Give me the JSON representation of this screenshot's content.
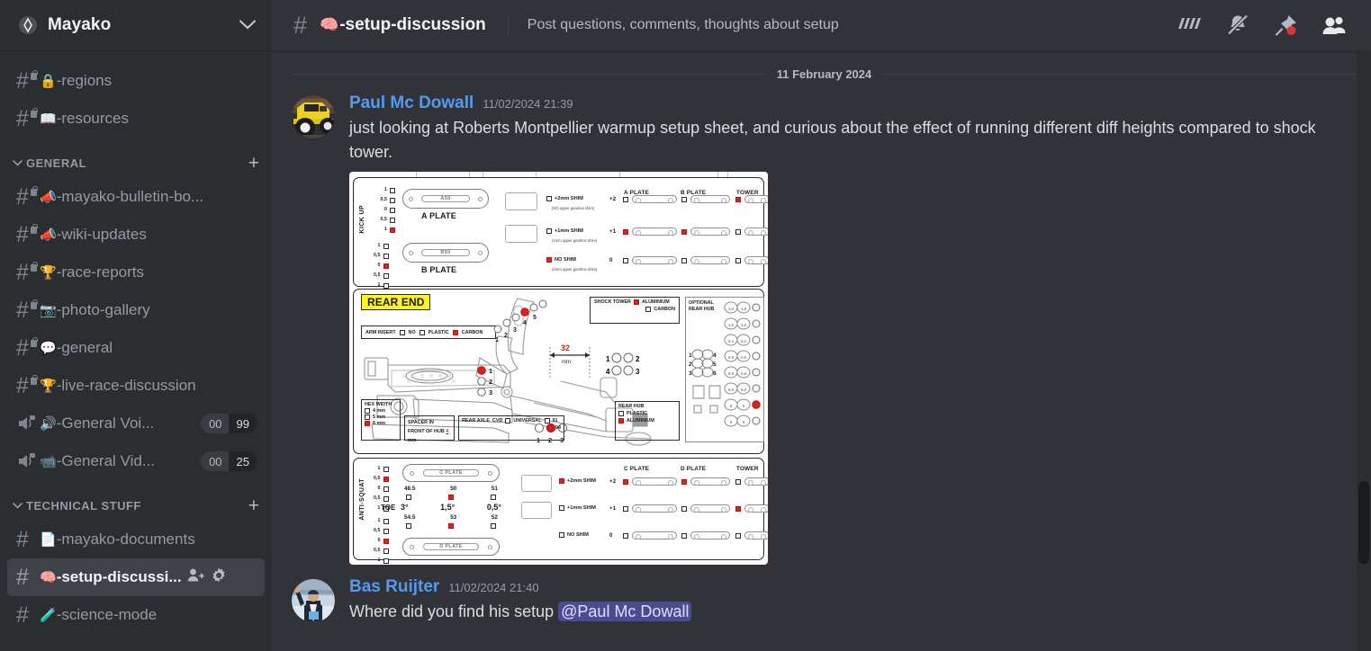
{
  "server": {
    "name": "Mayako",
    "icon": "server-diamond-icon",
    "collapse_icon": "chevron-down-icon"
  },
  "sidebar": {
    "top_channels": [
      {
        "emoji": "🔒",
        "name": "-regions",
        "locked": true,
        "type": "text"
      },
      {
        "emoji": "📖",
        "name": "-resources",
        "locked": true,
        "type": "text"
      }
    ],
    "categories": [
      {
        "label": "GENERAL",
        "add_label": "+",
        "channels": [
          {
            "emoji": "📣",
            "name": "-mayako-bulletin-bo...",
            "locked": true,
            "type": "text"
          },
          {
            "emoji": "📣",
            "name": "-wiki-updates",
            "locked": true,
            "type": "text"
          },
          {
            "emoji": "🏆",
            "name": "-race-reports",
            "locked": true,
            "type": "text"
          },
          {
            "emoji": "📷",
            "name": "-photo-gallery",
            "locked": true,
            "type": "text"
          },
          {
            "emoji": "💬",
            "name": "-general",
            "locked": true,
            "type": "text"
          },
          {
            "emoji": "🏆",
            "name": "-live-race-discussion",
            "locked": true,
            "type": "text"
          },
          {
            "emoji": "🔊",
            "name": "-General Voi...",
            "locked": true,
            "type": "voice",
            "badge_left": "00",
            "badge_right": "99"
          },
          {
            "emoji": "📹",
            "name": "-General Vid...",
            "locked": true,
            "type": "voice",
            "badge_left": "00",
            "badge_right": "25"
          }
        ]
      },
      {
        "label": "TECHNICAL STUFF",
        "add_label": "+",
        "channels": [
          {
            "emoji": "📄",
            "name": "-mayako-documents",
            "locked": false,
            "type": "text"
          },
          {
            "emoji": "🧠",
            "name": "-setup-discussi...",
            "locked": false,
            "type": "text",
            "active": true,
            "trailing_icons": [
              "add-member-icon",
              "gear-icon"
            ]
          },
          {
            "emoji": "🧪",
            "name": "-science-mode",
            "locked": false,
            "type": "text"
          }
        ]
      }
    ]
  },
  "header": {
    "hash": "#",
    "channel_emoji": "🧠",
    "channel_name": "-setup-discussion",
    "topic": "Post questions, comments, thoughts about setup",
    "icons": [
      {
        "name": "threads-icon",
        "label": "Threads"
      },
      {
        "name": "bell-muted-icon",
        "label": "Notification Settings Muted"
      },
      {
        "name": "pin-icon",
        "label": "Pinned Messages",
        "has_dot": true,
        "dot_color": "#da373c"
      },
      {
        "name": "members-icon",
        "label": "Show Member List"
      }
    ]
  },
  "chat": {
    "date_separator": "11 February 2024",
    "messages": [
      {
        "author": "Paul Mc Dowall",
        "timestamp": "11/02/2024 21:39",
        "avatar": "rc-truck-avatar",
        "text": "just looking at Roberts Montpellier warmup setup sheet, and curious about the effect of running different diff heights compared to shock tower.",
        "attachment": "setup-sheet-image"
      },
      {
        "author": "Bas Ruijter",
        "timestamp": "11/02/2024 21:40",
        "avatar": "person-avatar",
        "text_before": "Where did you find his setup ",
        "mention": "@Paul Mc Dowall"
      }
    ]
  },
  "setup_sheet": {
    "kick_up": {
      "label": "KICK UP",
      "a_plate_scale": [
        "1",
        "0,5",
        "0",
        "0,5",
        "1"
      ],
      "a_plate_selected": 4,
      "b_plate_scale": [
        "1",
        "0,5",
        "0",
        "0,5",
        "1"
      ],
      "b_plate_selected": 2,
      "a_plate_name": "A PLATE",
      "a_plate_code": "A50",
      "b_plate_name": "B PLATE",
      "b_plate_code": "B50",
      "shim_rows": [
        {
          "label": "+2mm SHIM",
          "note": "(NO upper gearbox shim)",
          "selected": false,
          "offset": "+2",
          "a_plate": false,
          "b_plate": false,
          "tower": true
        },
        {
          "label": "+1mm SHIM",
          "note": "(1mm upper gearbox shim)",
          "selected": false,
          "offset": "+1",
          "a_plate": true,
          "b_plate": true,
          "tower": false
        },
        {
          "label": "NO SHIM",
          "note": "(2mm upper gearbox shim)",
          "selected": true,
          "offset": "0",
          "a_plate": false,
          "b_plate": false,
          "tower": false
        }
      ],
      "col_headers": [
        "A PLATE",
        "B PLATE",
        "TOWER"
      ]
    },
    "rear_end": {
      "title": "REAR END",
      "arm_insert": {
        "label": "ARM INSERT",
        "options": [
          "NO",
          "PLASTIC",
          "CARBON"
        ],
        "selected": "CARBON"
      },
      "shock_tower": {
        "label": "SHOCK TOWER",
        "options": [
          "ALUMINIUM",
          "CARBON"
        ],
        "selected": "ALUMINIUM"
      },
      "optional_rear_hub": "OPTIONAL REAR HUB",
      "hub_numbers_left": [
        "1",
        "2",
        "3"
      ],
      "hub_numbers_right": [
        "4",
        "5",
        "6"
      ],
      "camber_positions": [
        "1",
        "2",
        "3",
        "4",
        "5"
      ],
      "camber_selected": 3,
      "arm_positions": [
        "1",
        "2",
        "3"
      ],
      "arm_selected": 1,
      "measure": "32",
      "measure_unit": "mm",
      "roll_numbers_top": [
        "1",
        "2"
      ],
      "roll_numbers_bottom": [
        "4",
        "3"
      ],
      "ride_positions": [
        "1",
        "2",
        "3"
      ],
      "ride_selected": 2,
      "hex_width": {
        "label": "HEX WIDTH",
        "options": [
          "4 mm",
          "5 mm",
          "6 mm"
        ],
        "selected": "6 mm"
      },
      "spacer": {
        "label": "SPACER IN FRONT OF HUB",
        "value": "4",
        "unit": "mm"
      },
      "rear_axle": {
        "label": "REAR AXLE",
        "cvd": "CVD",
        "universal": "UNIVERSAL",
        "opt91": "91",
        "opt94": "94",
        "selected": "94"
      },
      "rear_hub": {
        "label": "REAR HUB",
        "options": [
          "PLASTIC",
          "ALUMINIUM"
        ],
        "selected": "ALUMINIUM"
      },
      "hub_col_labels": [
        "1.0",
        "1.0",
        "1.0",
        "1.0",
        "0.1",
        "0.1",
        "0.5",
        "0.5",
        "0.5",
        "0.5",
        "5.0",
        "5.0",
        "0",
        "0",
        "0",
        "0",
        "0",
        "0"
      ]
    },
    "anti_squat": {
      "label": "ANTI-SQUAT",
      "c_plate_scale": [
        "1",
        "0,5",
        "0",
        "0,5",
        "1"
      ],
      "c_plate_selected": 1,
      "d_plate_scale": [
        "1",
        "0,5",
        "0",
        "0,5",
        "1"
      ],
      "d_plate_selected": 2,
      "c_plate_name": "C PLATE",
      "d_plate_name": "D PLATE",
      "toe_label": "TOE",
      "toe_top_values": [
        "48.5",
        "50",
        "51"
      ],
      "toe_top_selected": 1,
      "toe_angles": [
        "3°",
        "1,5°",
        "0,5°"
      ],
      "toe_bottom_values": [
        "54.5",
        "53",
        "52"
      ],
      "toe_bottom_selected": 1,
      "shim_rows": [
        {
          "label": "+2mm SHIM",
          "selected": true,
          "offset": "+2",
          "c_plate": true,
          "d_plate": true,
          "tower": false
        },
        {
          "label": "+1mm SHIM",
          "selected": false,
          "offset": "+1",
          "c_plate": false,
          "d_plate": false,
          "tower": true
        },
        {
          "label": "NO SHIM",
          "selected": false,
          "offset": "0",
          "c_plate": false,
          "d_plate": false,
          "tower": false
        }
      ],
      "col_headers": [
        "C PLATE",
        "D PLATE",
        "TOWER"
      ]
    }
  },
  "colors": {
    "accent_blue": "#529bf2",
    "mention_bg": "#4b4b8f",
    "sidebar_bg": "#2b2d31",
    "main_bg": "#313338",
    "red_marker": "#e02020",
    "pin_dot": "#da373c"
  }
}
